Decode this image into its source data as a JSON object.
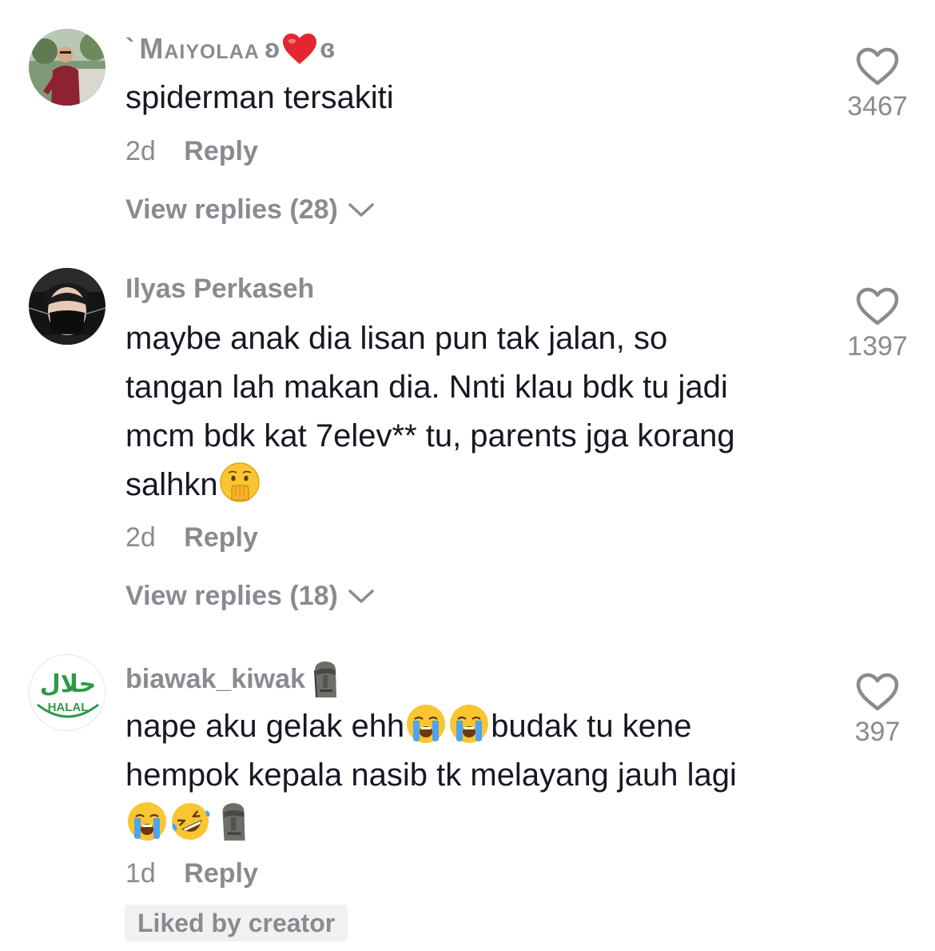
{
  "comments": [
    {
      "username_prefix": "`",
      "username": "Maiyolaa",
      "username_left": "ʚ",
      "username_right": "ɞ",
      "text": "spiderman tersakiti",
      "age": "2d",
      "reply_label": "Reply",
      "view_replies": "View replies (28)",
      "likes": "3467",
      "avatar_icon": "person-avatar-icon"
    },
    {
      "username": "Ilyas Perkaseh",
      "text_lines": [
        "maybe anak dia lisan pun tak jalan, so",
        "tangan lah makan dia. Nnti klau bdk tu jadi",
        "mcm bdk kat 7elev** tu, parents jga korang",
        "salhkn"
      ],
      "age": "2d",
      "reply_label": "Reply",
      "view_replies": "View replies (18)",
      "likes": "1397",
      "avatar_icon": "masked-person-avatar-icon"
    },
    {
      "username": "biawak_kiwak",
      "avatar_text": "HALAL",
      "avatar_arabic": "حلال",
      "text_line1_a": "nape aku gelak ehh",
      "text_line1_b": "budak tu kene",
      "text_line2": "hempok kepala nasib tk melayang jauh lagi",
      "age": "1d",
      "reply_label": "Reply",
      "liked_by_creator": "Liked by creator",
      "likes": "397",
      "avatar_icon": "halal-logo-icon"
    }
  ],
  "colors": {
    "primary_text": "#161823",
    "secondary_text": "#8a8b91",
    "badge_bg": "#f1f1f2",
    "halal_green": "#2e9a47",
    "heart_red": "#e3262f"
  }
}
